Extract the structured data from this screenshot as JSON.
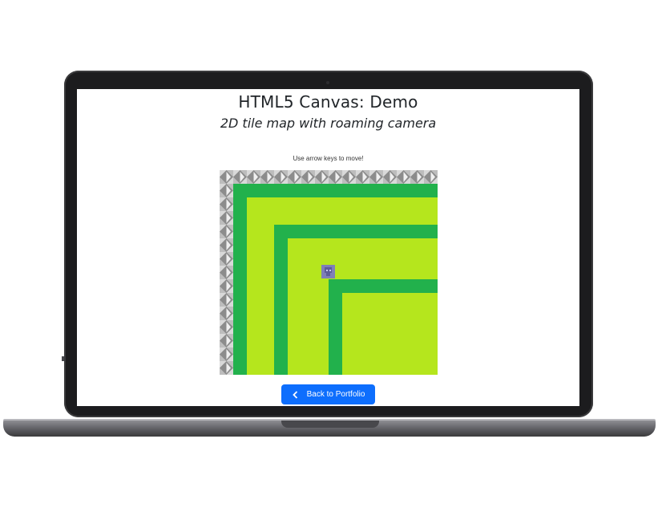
{
  "page": {
    "title": "HTML5 Canvas: Demo",
    "subtitle": "2D tile map with roaming camera",
    "hint": "Use arrow keys to move!",
    "back_button_label": "Back to Portfolio"
  },
  "game": {
    "tile_map": {
      "legend": {
        "rock": "#a3a3a3",
        "grass": "#22b14c",
        "field": "#b5e61d"
      },
      "player_color": "#7f7fb8"
    }
  },
  "colors": {
    "accent": "#0d6efd",
    "text": "#212529",
    "laptop_body": "#1c1c1e"
  }
}
